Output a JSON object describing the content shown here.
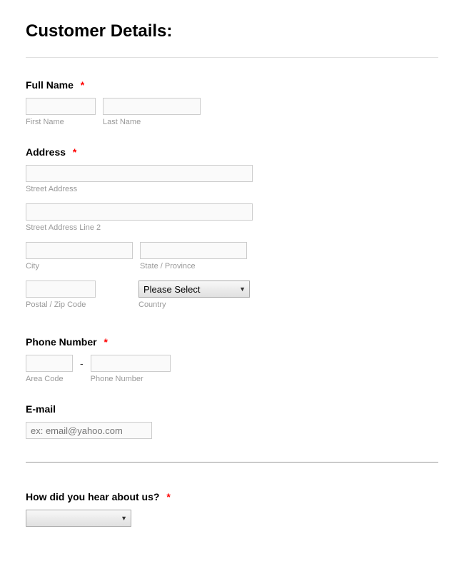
{
  "title": "Customer Details:",
  "fullName": {
    "label": "Full Name",
    "required": "*",
    "firstSub": "First Name",
    "lastSub": "Last Name"
  },
  "address": {
    "label": "Address",
    "required": "*",
    "streetSub": "Street Address",
    "street2Sub": "Street Address Line 2",
    "citySub": "City",
    "stateSub": "State / Province",
    "postalSub": "Postal / Zip Code",
    "countrySub": "Country",
    "countryPlaceholder": "Please Select"
  },
  "phone": {
    "label": "Phone Number",
    "required": "*",
    "areaSub": "Area Code",
    "phoneSub": "Phone Number",
    "dash": "-"
  },
  "email": {
    "label": "E-mail",
    "placeholder": "ex: email@yahoo.com"
  },
  "hearAbout": {
    "label": "How did you hear about us?",
    "required": "*"
  }
}
